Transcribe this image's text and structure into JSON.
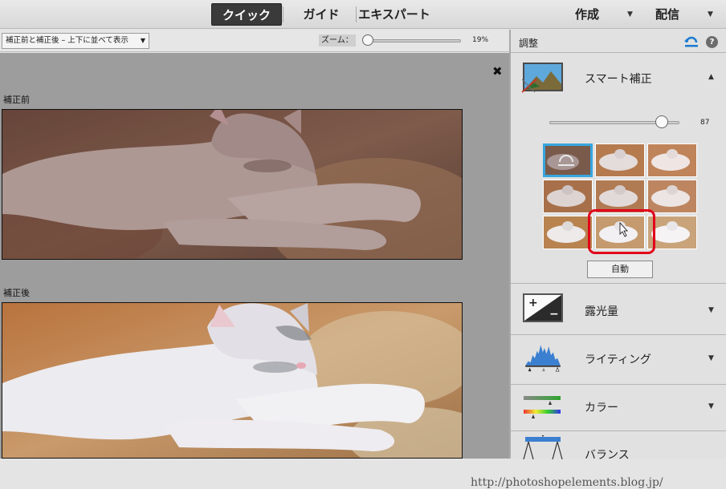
{
  "modes": {
    "quick": "クイック",
    "guide": "ガイド",
    "expert": "エキスパート"
  },
  "menus": {
    "create": "作成",
    "share": "配信"
  },
  "options": {
    "view_mode": "補正前と補正後 – 上下に並べて表示",
    "zoom_label": "ズーム：",
    "zoom_percent": 19,
    "zoom_value": "19%"
  },
  "canvas": {
    "before_label": "補正前",
    "after_label": "補正後",
    "watermark": "http://photoshopelements.blog.jp/"
  },
  "panel": {
    "title": "調整",
    "help_label": "?",
    "smart_fix": {
      "label": "スマート補正",
      "slider_value": 87,
      "slider_text": "87",
      "auto_label": "自動"
    },
    "sections": [
      {
        "label": "露光量"
      },
      {
        "label": "ライティング"
      },
      {
        "label": "カラー"
      },
      {
        "label": "バランス"
      }
    ]
  },
  "colors": {
    "accent_selected": "#37a6e0",
    "highlight_ring": "#e2001a",
    "active_mode_bg": "#3a3a3a"
  }
}
